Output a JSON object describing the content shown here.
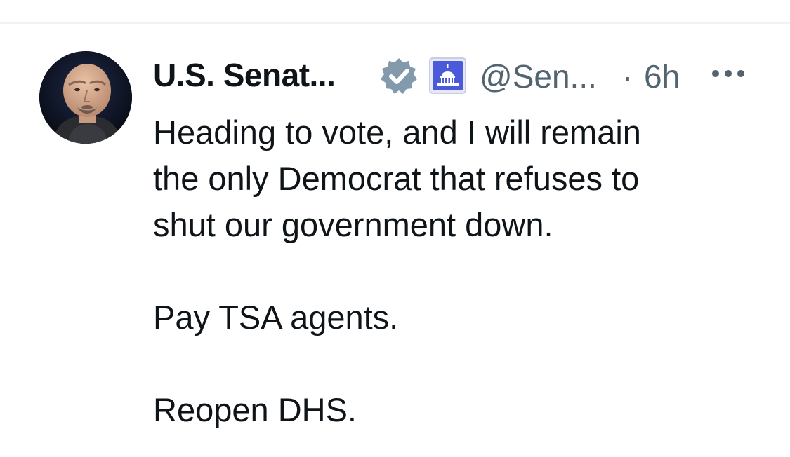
{
  "tweet": {
    "author": {
      "display_name": "U.S. Senat...",
      "handle": "@Sen...",
      "verified_icon": "verified-badge-icon",
      "affiliation_icon": "capitol-dome-icon",
      "avatar_icon": "avatar"
    },
    "separator": "·",
    "timestamp": "6h",
    "more_icon": "more-options-icon",
    "text": {
      "line1": "Heading to vote, and I will remain",
      "line2": "the only Democrat that refuses to",
      "line3": "shut our government down.",
      "para2": "Pay TSA agents.",
      "para3": "Reopen DHS."
    },
    "colors": {
      "text_primary": "#0f1419",
      "text_secondary": "#536471",
      "verified_badge": "#829aab",
      "affiliation_bg": "#4a5ad8"
    }
  }
}
